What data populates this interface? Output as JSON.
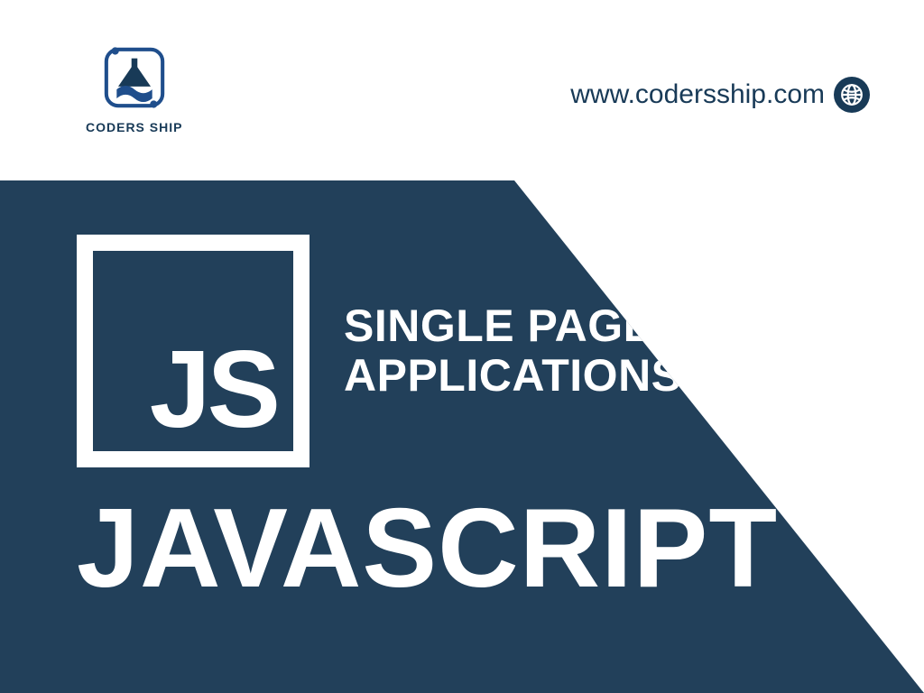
{
  "brand": {
    "name": "CODERS SHIP",
    "color_primary": "#183a57",
    "color_hero": "#22405a"
  },
  "site_url": "www.codersship.com",
  "hero": {
    "badge_text": "JS",
    "subtitle_line1": "SINGLE PAGE",
    "subtitle_line2": "APPLICATIONS",
    "title": "JAVASCRIPT"
  }
}
